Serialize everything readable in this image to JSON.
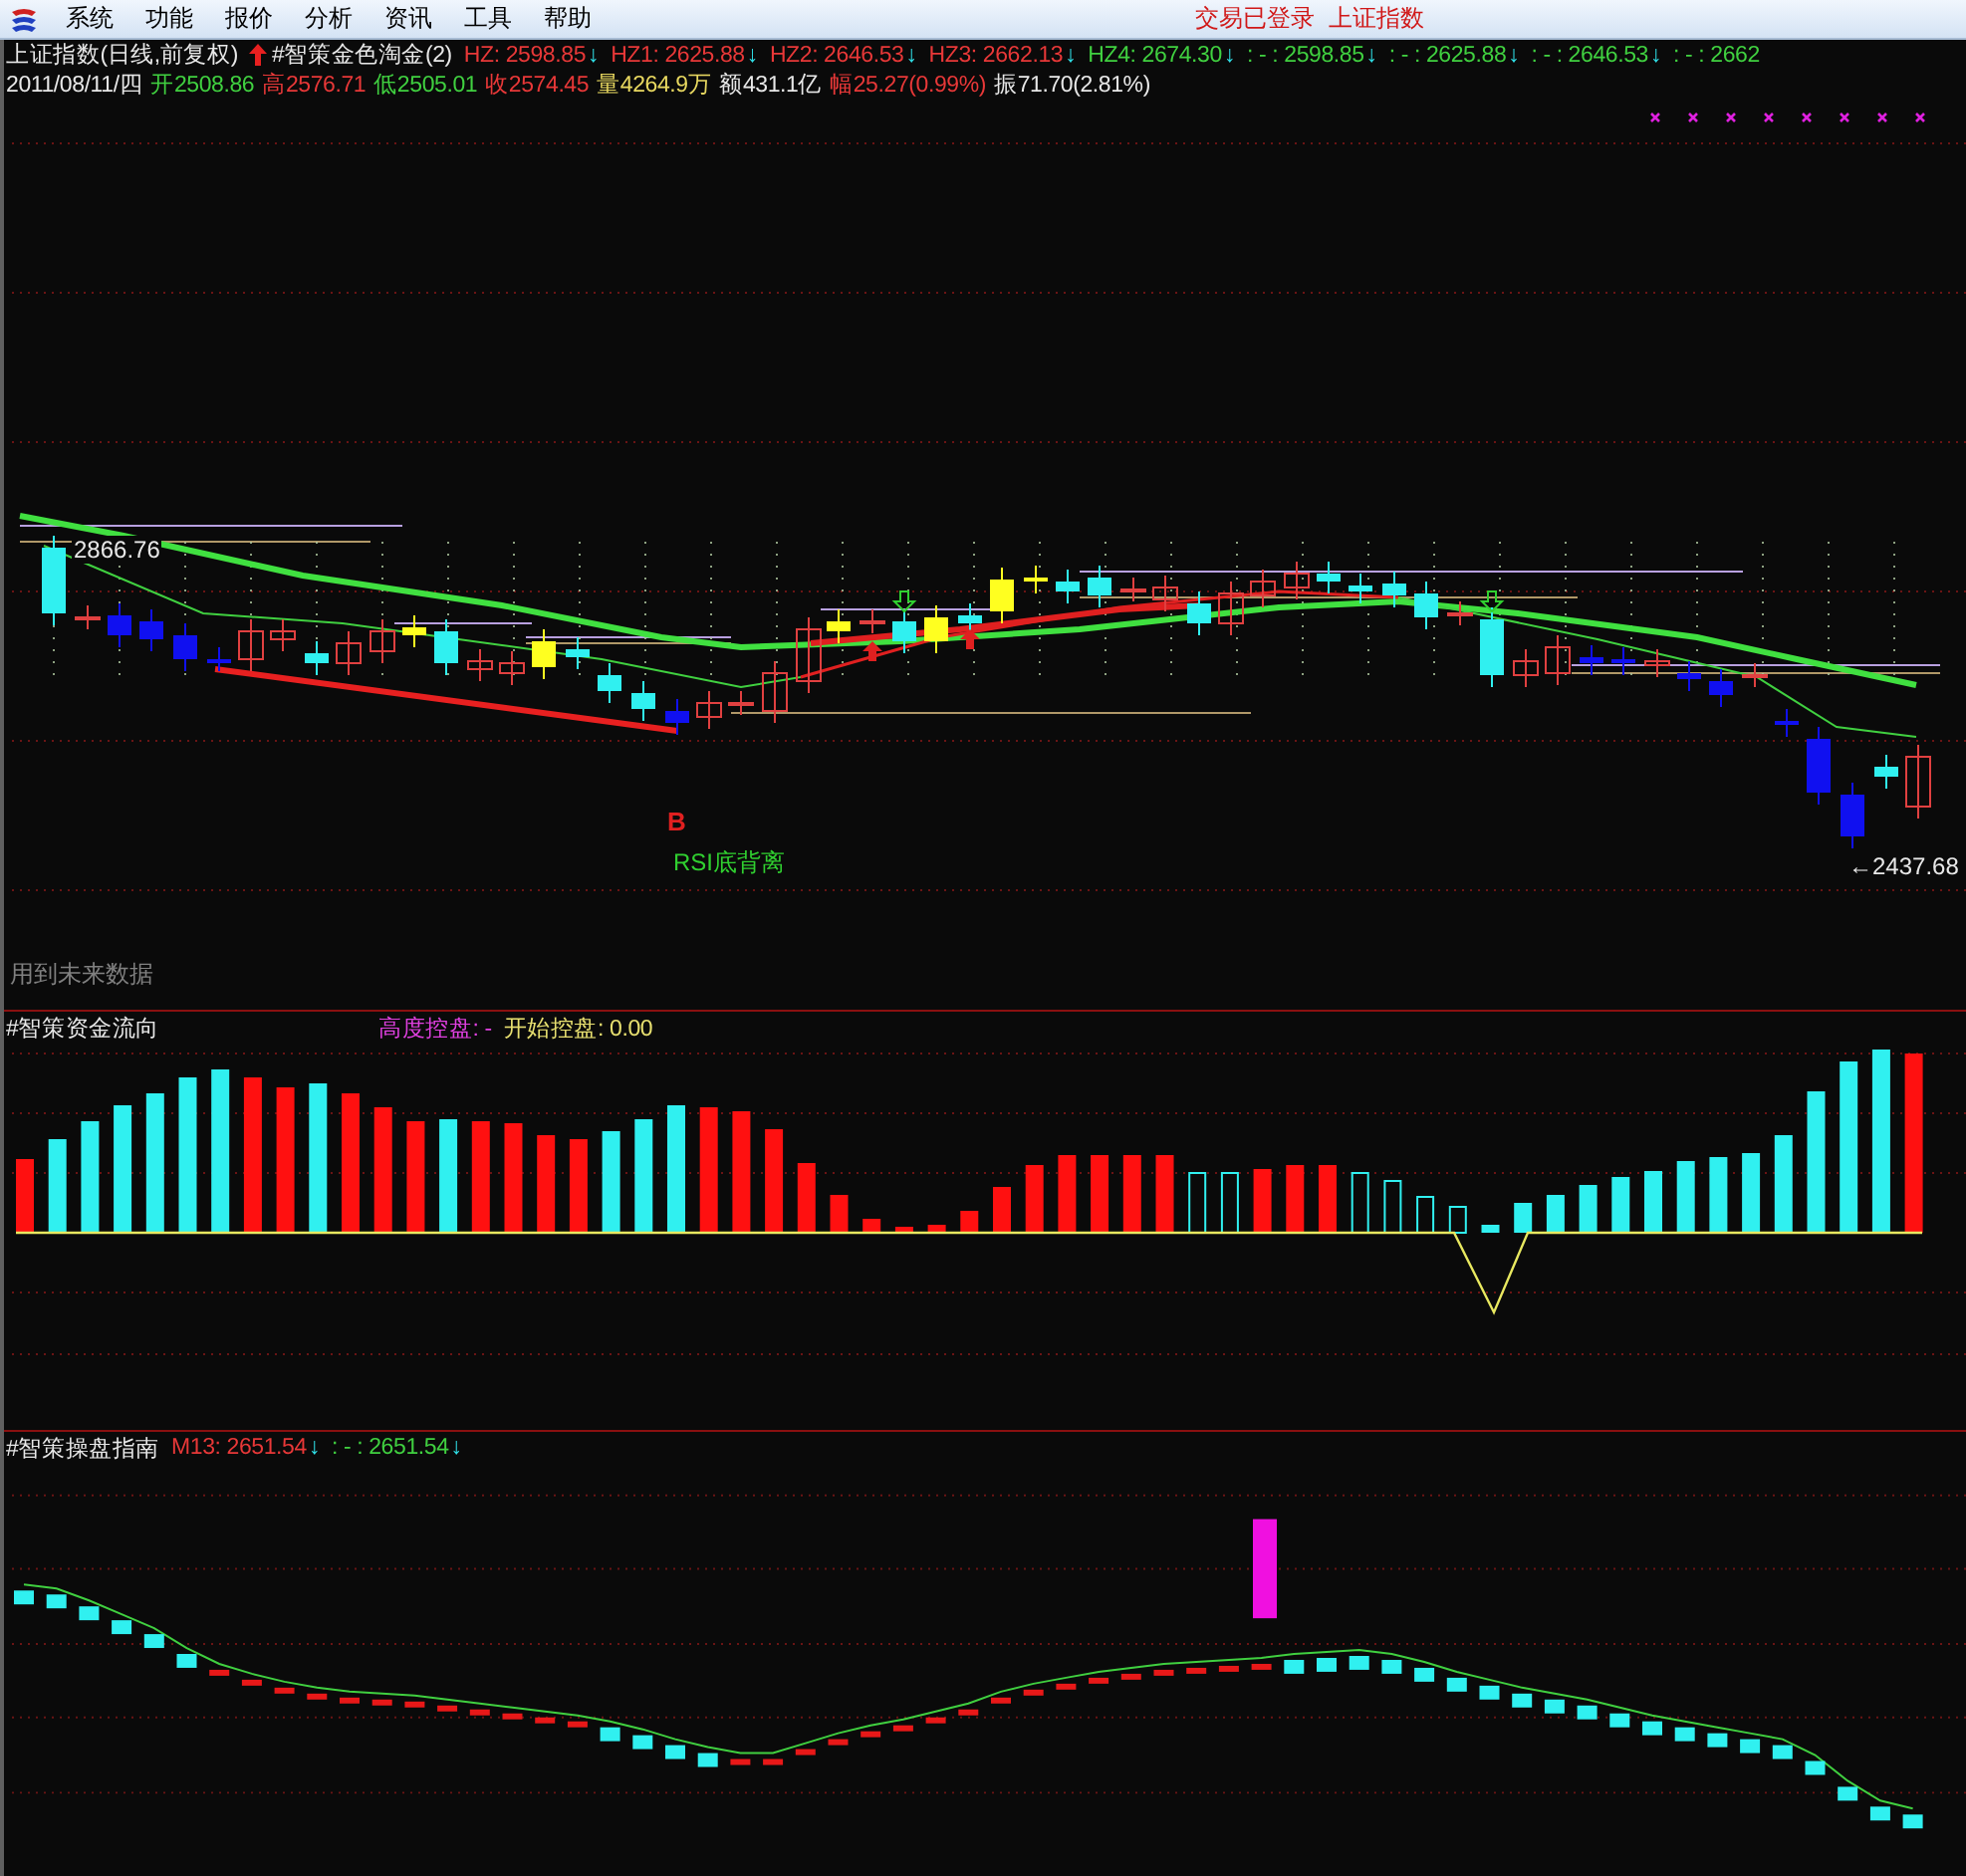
{
  "menu": {
    "items": [
      {
        "label": "系统"
      },
      {
        "label": "功能"
      },
      {
        "label": "报价"
      },
      {
        "label": "分析"
      },
      {
        "label": "资讯"
      },
      {
        "label": "工具"
      },
      {
        "label": "帮助"
      }
    ],
    "status": [
      "交易已登录",
      "上证指数"
    ]
  },
  "price_pane": {
    "title": "上证指数(日线,前复权)",
    "indicator": "#智策金色淘金(2)",
    "values": [
      {
        "text": "HZ: 2598.85",
        "color": "#e83838",
        "arrow": "↓"
      },
      {
        "text": "HZ1: 2625.88",
        "color": "#e83838",
        "arrow": "↓"
      },
      {
        "text": "HZ2: 2646.53",
        "color": "#e83838",
        "arrow": "↓"
      },
      {
        "text": "HZ3: 2662.13",
        "color": "#e83838",
        "arrow": "↓"
      },
      {
        "text": "HZ4: 2674.30",
        "color": "#40d040",
        "arrow": "↓"
      },
      {
        "text": ": - : 2598.85",
        "color": "#40d040",
        "arrow": "↓"
      },
      {
        "text": ": - : 2625.88",
        "color": "#40d040",
        "arrow": "↓"
      },
      {
        "text": ": - : 2646.53",
        "color": "#40d040",
        "arrow": "↓"
      },
      {
        "text": ": - : 2662",
        "color": "#40d040"
      }
    ],
    "quote": {
      "date": "2011/08/11/四",
      "fields": [
        {
          "text": "开2508.86",
          "color": "#40d040"
        },
        {
          "text": "高2576.71",
          "color": "#e83838"
        },
        {
          "text": "低2505.01",
          "color": "#40d040"
        },
        {
          "text": "收2574.45",
          "color": "#e83838"
        },
        {
          "text": "量4264.9万",
          "color": "#e8d860"
        },
        {
          "text": "额431.1亿",
          "color": "#e8e8e8"
        },
        {
          "text": "幅25.27(0.99%)",
          "color": "#e83838"
        },
        {
          "text": "振71.70(2.81%)",
          "color": "#e8e8e8"
        }
      ]
    },
    "high_label": "2866.76",
    "low_label": "←2437.68",
    "signal": "B",
    "signal_note": "RSI底背离",
    "footnote": "用到未来数据"
  },
  "fund_pane": {
    "title": "#智策资金流向",
    "values": [
      {
        "text": "高度控盘: -",
        "color": "#e040e0"
      },
      {
        "text": "开始控盘: 0.00",
        "color": "#e8e070"
      }
    ]
  },
  "guide_pane": {
    "title": "#智策操盘指南",
    "values": [
      {
        "text": "M13: 2651.54",
        "color": "#e83838",
        "arrow": "↓"
      },
      {
        "text": ": - : 2651.54",
        "color": "#40d040",
        "arrow": "↓"
      }
    ]
  }
}
